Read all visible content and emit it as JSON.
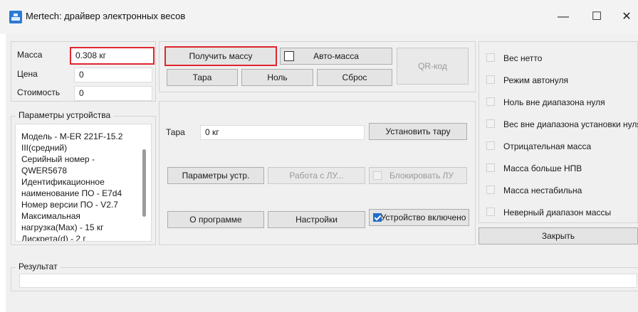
{
  "window": {
    "title": "Mertech: драйвер электронных весов",
    "minimize_glyph": "—",
    "maximize_glyph": "☐",
    "close_glyph": "✕"
  },
  "values": {
    "mass_label": "Масса",
    "mass_value": "0.308 кг",
    "price_label": "Цена",
    "price_value": "0",
    "cost_label": "Стоимость",
    "cost_value": "0"
  },
  "device_params": {
    "legend": "Параметры устройства",
    "lines": [
      "Модель - M-ER 221F-15.2",
      "III(средний)",
      "Серийный номер -",
      "QWER5678",
      "Идентификационное",
      "наименование ПО - E7d4",
      "Номер версии ПО - V2.7",
      "Максимальная",
      "нагрузка(Max) - 15 кг",
      "Дискрета(d) - 2 г"
    ]
  },
  "top_buttons": {
    "get_mass": "Получить массу",
    "auto_mass": "Авто-масса",
    "qr": "QR-код",
    "tare": "Тара",
    "zero": "Ноль",
    "reset": "Сброс"
  },
  "controls": {
    "tare_label": "Тара",
    "tare_value": "0 кг",
    "set_tare": "Установить тару",
    "device_params_btn": "Параметры устр.",
    "work_lu": "Работа с ЛУ...",
    "block_lu": "Блокировать ЛУ",
    "about": "О программе",
    "settings": "Настройки",
    "device_on": "Устройство включено"
  },
  "flags": [
    "Вес нетто",
    "Режим автонуля",
    "Ноль вне диапазона нуля",
    "Вес вне диапазона установки нуля",
    "Отрицательная масса",
    "Масса больше НПВ",
    "Масса нестабильна",
    "Неверный диапазон массы"
  ],
  "close_button": "Закрыть",
  "result": {
    "legend": "Результат",
    "value": ""
  },
  "colors": {
    "highlight": "#e0262e",
    "accent": "#1f6fc9"
  }
}
